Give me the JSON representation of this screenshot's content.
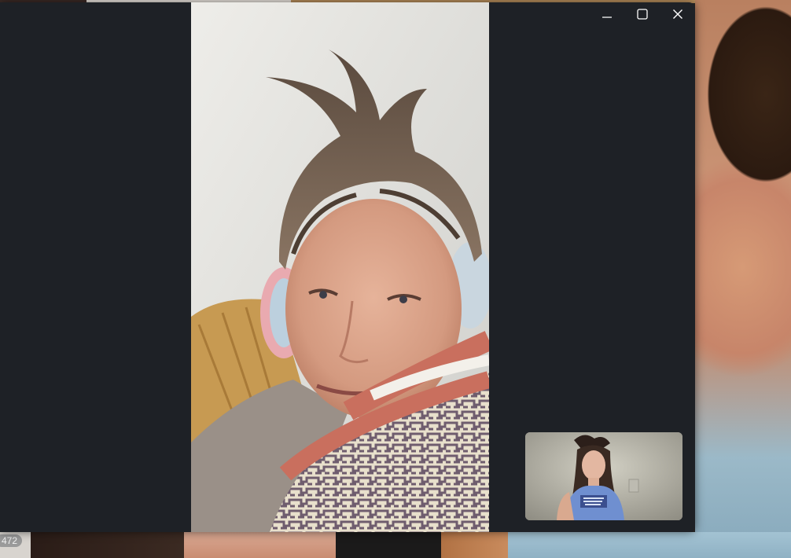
{
  "background": {
    "participant_count_badge": "472"
  },
  "window": {
    "controls": [
      {
        "name": "minimize-button",
        "icon": "minimize-icon"
      },
      {
        "name": "maximize-button",
        "icon": "maximize-icon"
      },
      {
        "name": "close-button",
        "icon": "close-icon"
      }
    ],
    "background_color": "#1e2126",
    "icon_color": "#ffffff"
  },
  "remote_video": {
    "content": "video-frame"
  },
  "self_preview": {
    "content": "video-frame"
  }
}
